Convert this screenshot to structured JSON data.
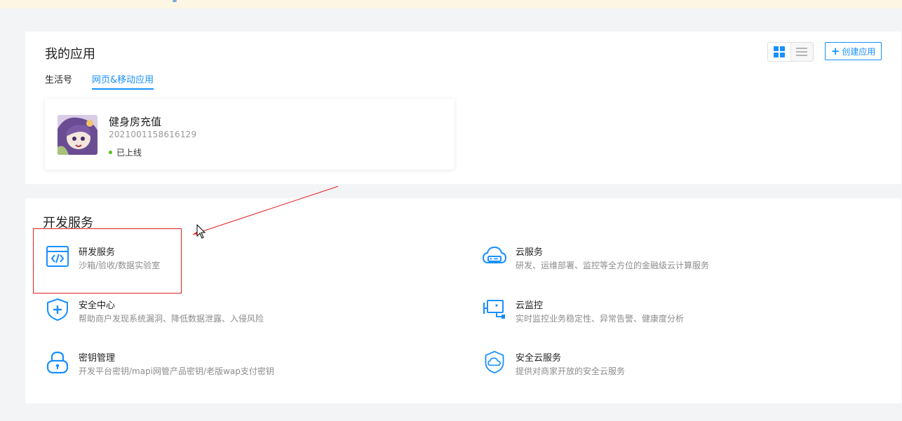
{
  "colors": {
    "accent": "#1890ff",
    "icon": "#1890ff",
    "annotation": "#e02020",
    "online": "#52c41a"
  },
  "my_apps": {
    "title": "我的应用",
    "tabs": [
      {
        "label": "生活号",
        "active": false
      },
      {
        "label": "网页&移动应用",
        "active": true
      }
    ],
    "view_toggle": {
      "grid_icon": "grid-icon",
      "list_icon": "list-icon",
      "selected": "grid"
    },
    "create_button": {
      "label": "创建应用",
      "icon": "plus-icon"
    },
    "apps": [
      {
        "name": "健身房充值",
        "id": "2021001158616129",
        "status": "已上线"
      }
    ]
  },
  "dev_services": {
    "title": "开发服务",
    "items": [
      {
        "name": "研发服务",
        "desc": "沙箱/验收/数据实验室",
        "icon": "code-window-icon"
      },
      {
        "name": "安全中心",
        "desc": "帮助商户发现系统漏洞、降低数据泄露、入侵风险",
        "icon": "shield-plus-icon"
      },
      {
        "name": "密钥管理",
        "desc": "开发平台密钥/mapi网管产品密钥/老版wap支付密钥",
        "icon": "lock-icon"
      },
      {
        "name": "云服务",
        "desc": "研发、运维部署、监控等全方位的金融级云计算服务",
        "icon": "cloud-server-icon"
      },
      {
        "name": "云监控",
        "desc": "实时监控业务稳定性、异常告警、健康度分析",
        "icon": "camera-monitor-icon"
      },
      {
        "name": "安全云服务",
        "desc": "提供对商家开放的安全云服务",
        "icon": "shield-cloud-icon"
      }
    ]
  }
}
